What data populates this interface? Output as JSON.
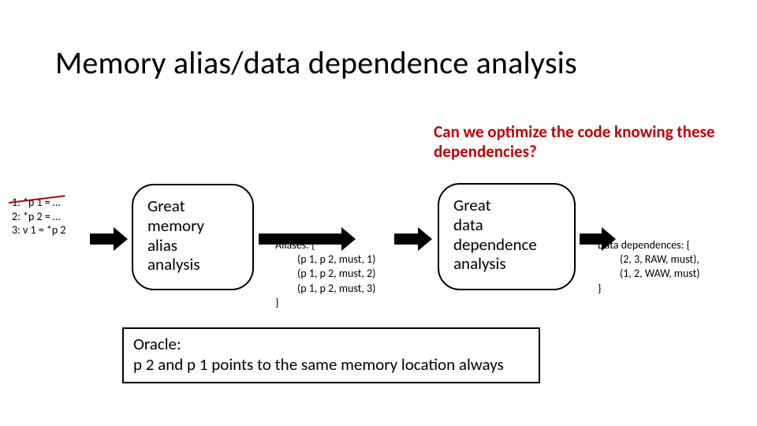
{
  "title": "Memory alias/data dependence analysis",
  "question": "Can we optimize the code knowing these dependencies?",
  "code": {
    "line1": "1: *p 1 = …",
    "line2": "2: *p 2 = …",
    "line3": "3: v 1 = *p 2"
  },
  "box_memory": "Great\nmemory\nalias\nanalysis",
  "box_dep": "Great\ndata\ndependence\nanalysis",
  "aliases": {
    "head": "Aliases: {",
    "l1": "(p 1, p 2, must, 1)",
    "l2": "(p 1, p 2, must, 2)",
    "l3": "(p 1, p 2, must, 3)",
    "tail": "}"
  },
  "dependences": {
    "head": "Data dependences: {",
    "l1": "(2, 3, RAW, must),",
    "l2": "(1, 2, WAW, must)",
    "tail": "}"
  },
  "oracle": "Oracle:\np 2 and p 1 points to the same memory location always"
}
